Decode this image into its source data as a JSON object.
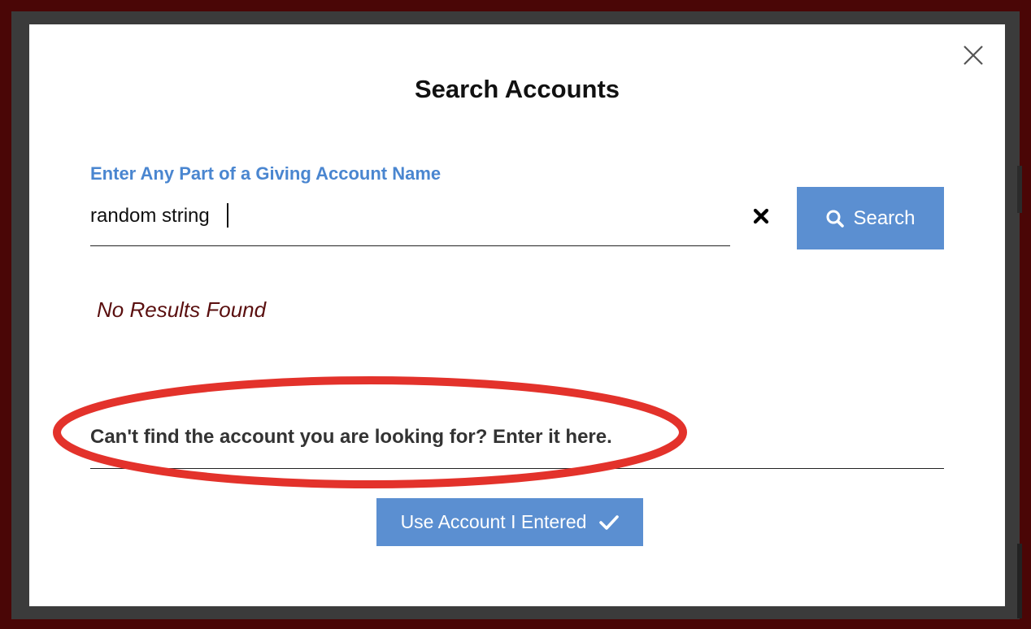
{
  "modal": {
    "title": "Search Accounts",
    "close_icon": "close-icon"
  },
  "search": {
    "label": "Enter Any Part of a Giving Account Name",
    "value": "random string",
    "clear_icon": "clear-x-icon",
    "button_label": "Search",
    "button_icon": "search-icon"
  },
  "results": {
    "message": "No Results Found"
  },
  "manual_entry": {
    "placeholder": "Can't find the account you are looking for? Enter it here.",
    "value": "",
    "button_label": "Use Account I Entered",
    "button_icon": "checkmark-icon"
  },
  "colors": {
    "accent": "#5b8fd1",
    "label_blue": "#4a86d0",
    "no_results": "#5a0f0f",
    "annotation_red": "#e3322b",
    "backdrop": "#4a0606"
  },
  "annotation": {
    "type": "red-ellipse-highlight"
  }
}
